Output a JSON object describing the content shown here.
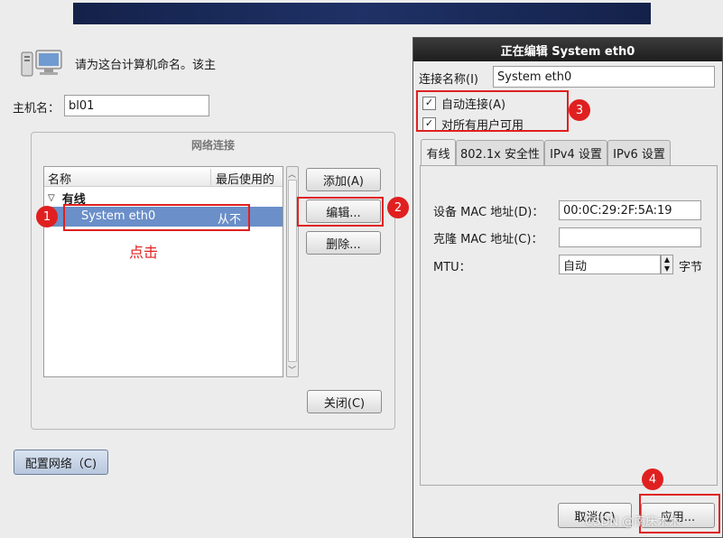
{
  "left_panel": {
    "prompt": "请为这台计算机命名。该主",
    "hostname_label": "主机名：",
    "hostname_value": "bl01",
    "config_network_button": "配置网络（C)"
  },
  "network_connections": {
    "title": "网络连接",
    "columns": [
      "名称",
      "最后使用的"
    ],
    "group_label": "有线",
    "selected_connection": {
      "name": "System eth0",
      "last_used": "从不"
    },
    "add_button": "添加(A)",
    "edit_button": "编辑...",
    "delete_button": "删除...",
    "close_button": "关闭(C)"
  },
  "edit_dialog": {
    "title": "正在编辑 System eth0",
    "connection_name_label": "连接名称(I)",
    "connection_name_value": "System eth0",
    "auto_connect_label": "自动连接(A)",
    "auto_connect_checked": true,
    "all_users_label": "对所有用户可用",
    "all_users_checked": true,
    "tabs": [
      "有线",
      "802.1x 安全性",
      "IPv4 设置",
      "IPv6 设置"
    ],
    "active_tab": "有线",
    "device_mac_label": "设备 MAC 地址(D)：",
    "device_mac_value": "00:0C:29:2F:5A:19",
    "cloned_mac_label": "克隆 MAC 地址(C)：",
    "cloned_mac_value": "",
    "mtu_label": "MTU：",
    "mtu_value": "自动",
    "mtu_unit": "字节",
    "cancel_button": "取消(C)",
    "apply_button": "应用..."
  },
  "annotations": {
    "click_hint": "点击",
    "step_1": "1",
    "step_2": "2",
    "step_3": "3",
    "step_4": "4",
    "highlight_color": "#e02020"
  },
  "watermark": "CSDN @南床木木"
}
